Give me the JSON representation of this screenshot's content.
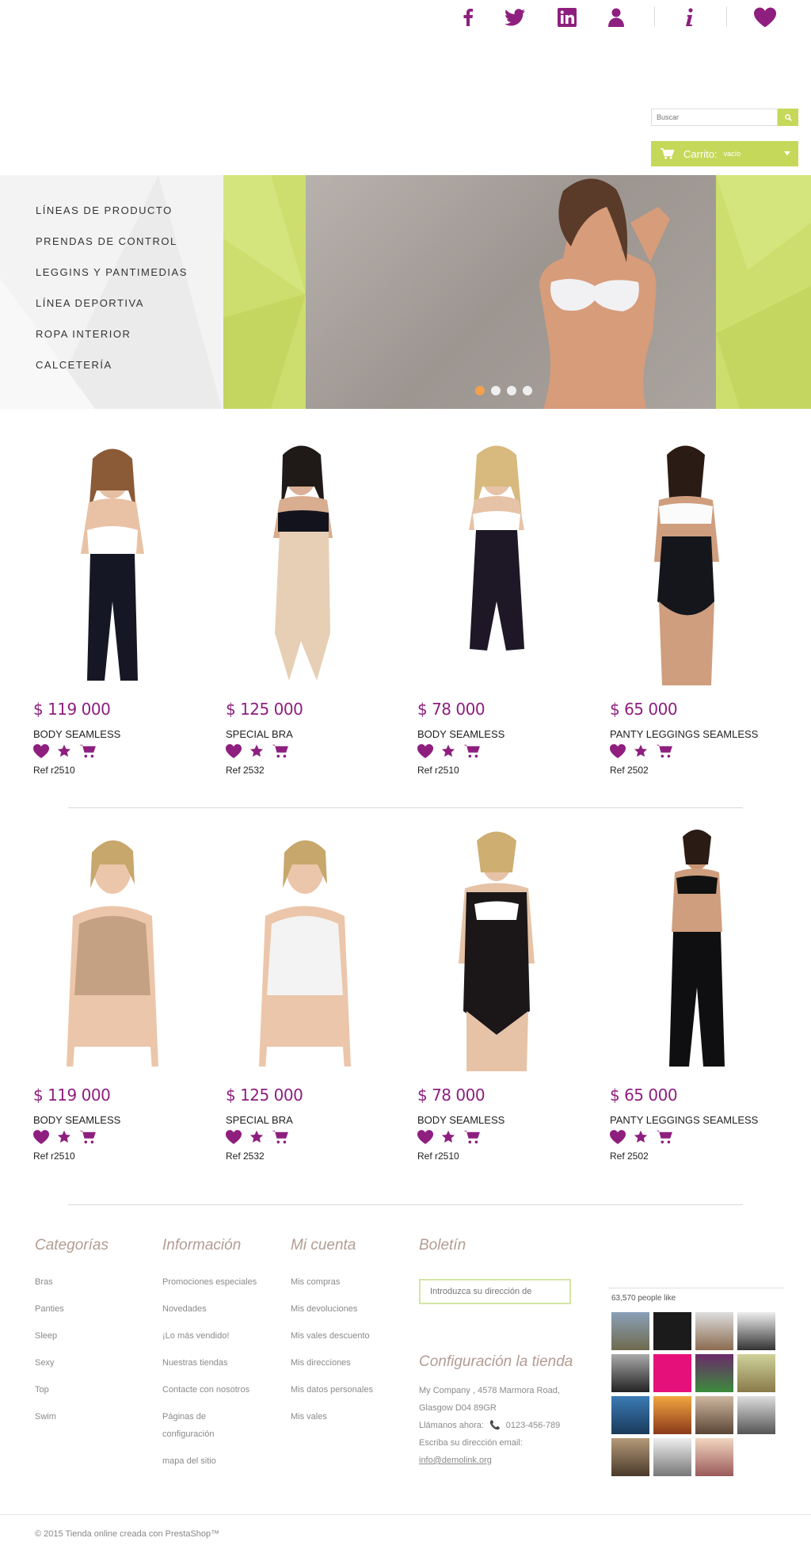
{
  "colors": {
    "accent": "#8e1f7f",
    "lime": "#c6d85a",
    "heading": "#b39c93"
  },
  "topbar": {
    "icons": [
      "facebook-icon",
      "twitter-icon",
      "linkedin-icon",
      "user-icon",
      "info-icon",
      "heart-icon"
    ]
  },
  "search": {
    "placeholder": "Buscar"
  },
  "cart": {
    "label": "Carrito:",
    "status": "vacío"
  },
  "hero": {
    "menu": [
      "LÍNEAS DE PRODUCTO",
      "PRENDAS DE CONTROL",
      "LEGGINS Y PANTIMEDIAS",
      "LÍNEA DEPORTIVA",
      "ROPA INTERIOR",
      "CALCETERÍA"
    ],
    "slides_count": 4,
    "active_slide": 1
  },
  "products_row1": [
    {
      "price": "$ 119 000",
      "name": "BODY SEAMLESS",
      "ref": "Ref r2510"
    },
    {
      "price": "$ 125 000",
      "name": "SPECIAL BRA",
      "ref": "Ref 2532"
    },
    {
      "price": "$ 78 000",
      "name": "BODY SEAMLESS",
      "ref": "Ref r2510"
    },
    {
      "price": "$ 65 000",
      "name": "PANTY LEGGINGS SEAMLESS",
      "ref": "Ref 2502"
    }
  ],
  "products_row2": [
    {
      "price": "$ 119 000",
      "name": "BODY SEAMLESS",
      "ref": "Ref r2510"
    },
    {
      "price": "$ 125 000",
      "name": "SPECIAL BRA",
      "ref": "Ref 2532"
    },
    {
      "price": "$ 78 000",
      "name": "BODY SEAMLESS",
      "ref": "Ref r2510"
    },
    {
      "price": "$ 65 000",
      "name": "PANTY LEGGINGS SEAMLESS",
      "ref": "Ref 2502"
    }
  ],
  "footer": {
    "categorias": {
      "title": "Categorías",
      "links": [
        "Bras",
        "Panties",
        "Sleep",
        "Sexy",
        "Top",
        "Swim"
      ]
    },
    "informacion": {
      "title": "Información",
      "links": [
        "Promociones especiales",
        "Novedades",
        "¡Lo más vendido!",
        "Nuestras tiendas",
        "Contacte con nosotros",
        "Páginas de configuración",
        "mapa del sitio"
      ]
    },
    "cuenta": {
      "title": "Mi cuenta",
      "links": [
        "Mis compras",
        "Mis devoluciones",
        "Mis vales descuento",
        "Mis direcciones",
        "Mis datos personales",
        "Mis vales"
      ]
    },
    "boletin": {
      "title": "Boletín",
      "placeholder": "Introduzca su dirección de"
    },
    "tienda": {
      "title": "Configuración la tienda",
      "address1": "My Company , 4578 Marmora Road,",
      "address2": "Glasgow D04 89GR",
      "phone_label": "Llámanos ahora:",
      "phone": "0123-456-789",
      "email_label": "Escriba su dirección email:",
      "email": "info@demolink.org"
    },
    "facebook": {
      "count": "63,570 people like"
    },
    "copyright": "© 2015 Tienda online creada con PrestaShop™"
  }
}
